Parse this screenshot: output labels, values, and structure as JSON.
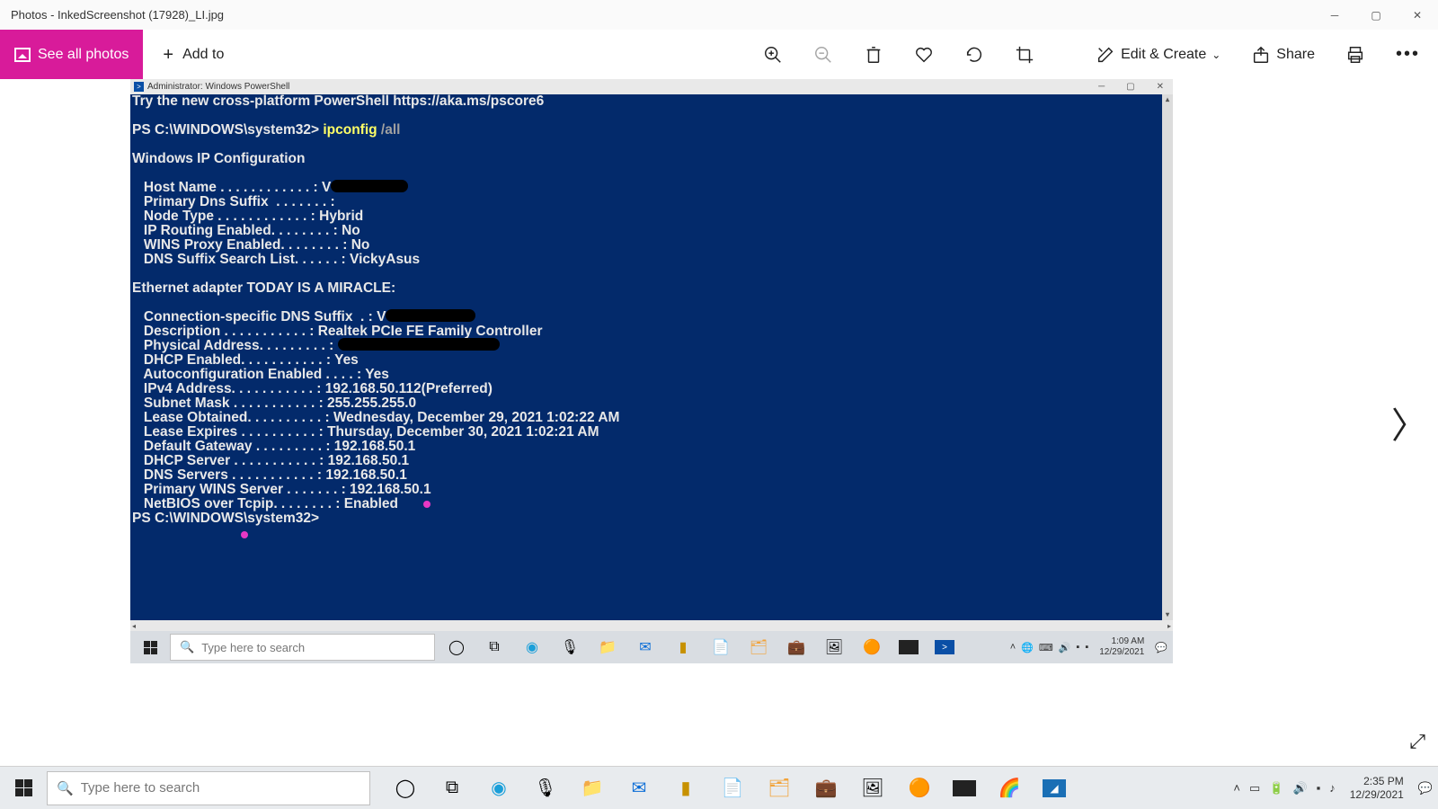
{
  "window": {
    "title": "Photos - InkedScreenshot (17928)_LI.jpg"
  },
  "toolbar": {
    "see_all": "See all photos",
    "add_to": "Add to",
    "edit_create": "Edit & Create",
    "share": "Share"
  },
  "inner_window": {
    "title": "Administrator: Windows PowerShell"
  },
  "terminal": {
    "banner": "Try the new cross-platform PowerShell https://aka.ms/pscore6",
    "prompt1": "PS C:\\WINDOWS\\system32> ",
    "command": "ipconfig ",
    "command_arg": "/all",
    "section_ipconfig": "Windows IP Configuration",
    "host_name_label": "   Host Name . . . . . . . . . . . . : V",
    "primary_dns_label": "   Primary Dns Suffix  . . . . . . . :",
    "node_type": "   Node Type . . . . . . . . . . . . : Hybrid",
    "ip_routing": "   IP Routing Enabled. . . . . . . . : No",
    "wins_proxy": "   WINS Proxy Enabled. . . . . . . . : No",
    "dns_suffix_list": "   DNS Suffix Search List. . . . . . : VickyAsus",
    "section_adapter": "Ethernet adapter TODAY IS A MIRACLE:",
    "conn_dns_label": "   Connection-specific DNS Suffix  . : V",
    "description": "   Description . . . . . . . . . . . : Realtek PCIe FE Family Controller",
    "phys_addr_label": "   Physical Address. . . . . . . . . : ",
    "dhcp_enabled": "   DHCP Enabled. . . . . . . . . . . : Yes",
    "autoconfig": "   Autoconfiguration Enabled . . . . : Yes",
    "ipv4": "   IPv4 Address. . . . . . . . . . . : 192.168.50.112(Preferred)",
    "subnet": "   Subnet Mask . . . . . . . . . . . : 255.255.255.0",
    "lease_obt": "   Lease Obtained. . . . . . . . . . : Wednesday, December 29, 2021 1:02:22 AM",
    "lease_exp": "   Lease Expires . . . . . . . . . . : Thursday, December 30, 2021 1:02:21 AM",
    "gateway": "   Default Gateway . . . . . . . . . : 192.168.50.1",
    "dhcp_server": "   DHCP Server . . . . . . . . . . . : 192.168.50.1",
    "dns_servers": "   DNS Servers . . . . . . . . . . . : 192.168.50.1",
    "primary_wins": "   Primary WINS Server . . . . . . . : 192.168.50.1",
    "netbios": "   NetBIOS over Tcpip. . . . . . . . : Enabled",
    "prompt2": "PS C:\\WINDOWS\\system32>"
  },
  "inner_taskbar": {
    "search_placeholder": "Type here to search",
    "time": "1:09 AM",
    "date": "12/29/2021"
  },
  "outer_taskbar": {
    "search_placeholder": "Type here to search",
    "time": "2:35 PM",
    "date": "12/29/2021"
  }
}
